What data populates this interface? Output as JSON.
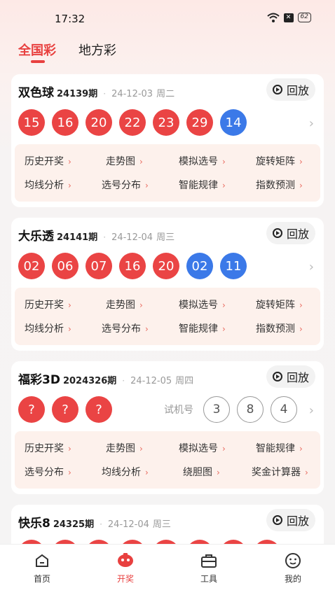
{
  "status": {
    "time": "17:32",
    "battery": "62"
  },
  "top_tabs": [
    "全国彩",
    "地方彩"
  ],
  "replay_label": "回放",
  "trial_label": "试机号",
  "cards": [
    {
      "name": "双色球",
      "issue": "24139期",
      "date": "24-12-03",
      "week": "周二",
      "balls": [
        {
          "n": "15",
          "c": "red"
        },
        {
          "n": "16",
          "c": "red"
        },
        {
          "n": "20",
          "c": "red"
        },
        {
          "n": "22",
          "c": "red"
        },
        {
          "n": "23",
          "c": "red"
        },
        {
          "n": "29",
          "c": "red"
        },
        {
          "n": "14",
          "c": "blue"
        }
      ],
      "links": [
        "历史开奖",
        "走势图",
        "模拟选号",
        "旋转矩阵",
        "均线分析",
        "选号分布",
        "智能规律",
        "指数预测"
      ]
    },
    {
      "name": "大乐透",
      "issue": "24141期",
      "date": "24-12-04",
      "week": "周三",
      "balls": [
        {
          "n": "02",
          "c": "red"
        },
        {
          "n": "06",
          "c": "red"
        },
        {
          "n": "07",
          "c": "red"
        },
        {
          "n": "16",
          "c": "red"
        },
        {
          "n": "20",
          "c": "red"
        },
        {
          "n": "02",
          "c": "blue"
        },
        {
          "n": "11",
          "c": "blue"
        }
      ],
      "links": [
        "历史开奖",
        "走势图",
        "模拟选号",
        "旋转矩阵",
        "均线分析",
        "选号分布",
        "智能规律",
        "指数预测"
      ]
    },
    {
      "name": "福彩3D",
      "issue": "2024326期",
      "date": "24-12-05",
      "week": "周四",
      "balls": [
        {
          "n": "?",
          "c": "red"
        },
        {
          "n": "?",
          "c": "red"
        },
        {
          "n": "?",
          "c": "red"
        }
      ],
      "trial": [
        "3",
        "8",
        "4"
      ],
      "links": [
        "历史开奖",
        "走势图",
        "模拟选号",
        "智能规律",
        "选号分布",
        "均线分析",
        "绕胆图",
        "奖金计算器"
      ]
    },
    {
      "name": "快乐8",
      "issue": "24325期",
      "date": "24-12-04",
      "week": "周三"
    }
  ],
  "tabbar": [
    {
      "label": "首页",
      "icon": "home-icon"
    },
    {
      "label": "开奖",
      "icon": "lottery-icon"
    },
    {
      "label": "工具",
      "icon": "toolbox-icon"
    },
    {
      "label": "我的",
      "icon": "profile-icon"
    }
  ]
}
